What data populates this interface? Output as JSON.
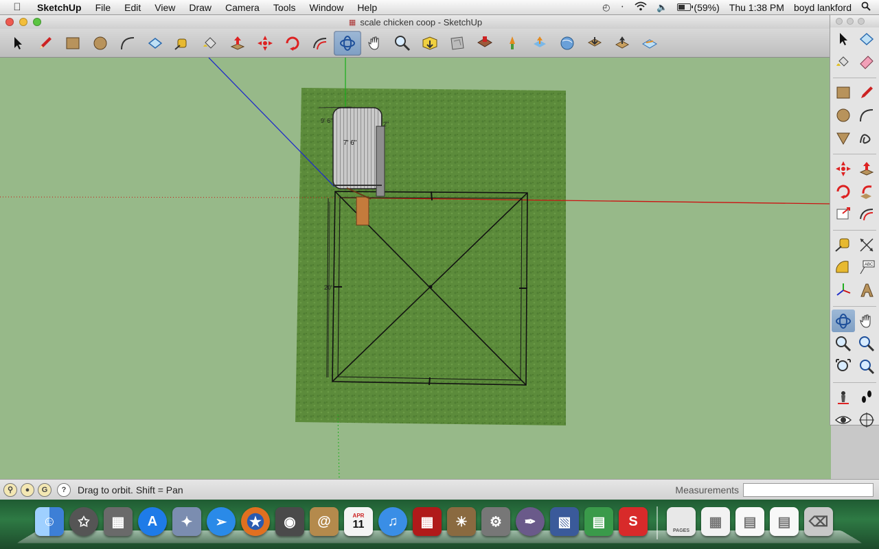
{
  "menubar": {
    "app_name": "SketchUp",
    "items": [
      "File",
      "Edit",
      "View",
      "Draw",
      "Camera",
      "Tools",
      "Window",
      "Help"
    ],
    "battery_percent": "(59%)",
    "battery_level": 0.59,
    "clock": "Thu 1:38 PM",
    "user": "boyd lankford"
  },
  "window": {
    "title": "scale chicken coop - SketchUp"
  },
  "toolbar": {
    "tools": [
      {
        "name": "select-tool",
        "icon": "arrow-icon"
      },
      {
        "name": "pencil-tool",
        "icon": "pencil-icon"
      },
      {
        "name": "rectangle-tool",
        "icon": "rectangle-icon"
      },
      {
        "name": "circle-tool",
        "icon": "circle-icon"
      },
      {
        "name": "arc-tool",
        "icon": "arc-icon"
      },
      {
        "name": "make-component-tool",
        "icon": "component-icon"
      },
      {
        "name": "eraser-tool",
        "icon": "eraser-icon"
      },
      {
        "name": "paint-bucket-tool",
        "icon": "paint-bucket-icon"
      },
      {
        "name": "push-pull-tool",
        "icon": "push-pull-icon"
      },
      {
        "name": "move-tool",
        "icon": "move-icon"
      },
      {
        "name": "rotate-tool",
        "icon": "rotate-icon"
      },
      {
        "name": "offset-tool",
        "icon": "offset-icon"
      },
      {
        "name": "orbit-tool",
        "icon": "orbit-icon",
        "active": true
      },
      {
        "name": "pan-tool",
        "icon": "hand-icon"
      },
      {
        "name": "zoom-tool",
        "icon": "zoom-icon"
      },
      {
        "name": "zoom-extents-tool",
        "icon": "zoom-extents-icon"
      },
      {
        "name": "previous-view-tool",
        "icon": "previous-icon"
      },
      {
        "name": "get-models-tool",
        "icon": "warehouse-icon"
      },
      {
        "name": "place-model-tool",
        "icon": "place-model-icon"
      },
      {
        "name": "share-model-tool",
        "icon": "share-icon"
      },
      {
        "name": "google-earth-tool",
        "icon": "earth-icon"
      },
      {
        "name": "get-photo-texture-tool",
        "icon": "photo-texture-icon"
      },
      {
        "name": "share-component-tool",
        "icon": "share-component-icon"
      },
      {
        "name": "add-location-tool",
        "icon": "location-icon"
      }
    ]
  },
  "viewport": {
    "dimension_labels": [
      "9' 6\"",
      "7' 6\"",
      "2\"",
      "20'"
    ]
  },
  "palette": {
    "tools": [
      "select-icon",
      "make-component-icon",
      "paint-bucket-icon",
      "eraser-icon",
      "rectangle-icon",
      "line-icon",
      "circle-icon",
      "arc-icon",
      "polygon-icon",
      "freehand-icon",
      "move-icon",
      "push-pull-icon",
      "rotate-icon",
      "follow-me-icon",
      "scale-icon",
      "offset-icon",
      "tape-measure-icon",
      "dimension-icon",
      "protractor-icon",
      "text-icon",
      "axes-icon",
      "3d-text-icon",
      "orbit-icon",
      "pan-icon",
      "zoom-icon",
      "zoom-window-icon",
      "zoom-extents-icon",
      "previous-view-icon",
      "position-camera-icon",
      "walk-icon",
      "look-around-icon",
      "section-plane-icon"
    ],
    "label_abc": "ABC"
  },
  "statusbar": {
    "hint": "Drag to orbit.  Shift = Pan",
    "measurements_label": "Measurements",
    "measurements_value": ""
  },
  "dock": {
    "apps": [
      {
        "name": "finder",
        "color": "#3d7fd6"
      },
      {
        "name": "dashboard",
        "color": "#555555"
      },
      {
        "name": "photo-browser",
        "color": "#6a6a6a"
      },
      {
        "name": "app-store",
        "color": "#1e7be8"
      },
      {
        "name": "preview",
        "color": "#7b8db0"
      },
      {
        "name": "safari",
        "color": "#2a8ae8"
      },
      {
        "name": "firefox",
        "color": "#e07020"
      },
      {
        "name": "facetime",
        "color": "#4a4a4a"
      },
      {
        "name": "address-book",
        "color": "#b48a4c"
      },
      {
        "name": "ical",
        "color": "#f4f4f4"
      },
      {
        "name": "itunes",
        "color": "#3a8ee6"
      },
      {
        "name": "photo-booth",
        "color": "#b01a1a"
      },
      {
        "name": "iphoto",
        "color": "#8a6a40"
      },
      {
        "name": "system-preferences",
        "color": "#777777"
      },
      {
        "name": "script-editor",
        "color": "#6a5a8a"
      },
      {
        "name": "keynote",
        "color": "#3a5a9a"
      },
      {
        "name": "numbers",
        "color": "#3a9a4a"
      },
      {
        "name": "sketchup",
        "color": "#d82a2a"
      },
      {
        "name": "pages",
        "color": "#e8e8e8"
      },
      {
        "name": "document-1",
        "color": "#f2f2f2"
      },
      {
        "name": "document-2",
        "color": "#f8f8f8"
      },
      {
        "name": "document-3",
        "color": "#f8f8f8"
      },
      {
        "name": "trash",
        "color": "#c8c8c8"
      }
    ],
    "ical_month": "APR",
    "ical_day": "11",
    "pages_label": "PAGES"
  },
  "colors": {
    "sky_ground": "#97b989",
    "grass": "#5b8a3a",
    "x_axis": "#cc1111",
    "y_axis": "#11aa11",
    "z_axis": "#1122cc",
    "active_tool": "#8fadd0"
  }
}
